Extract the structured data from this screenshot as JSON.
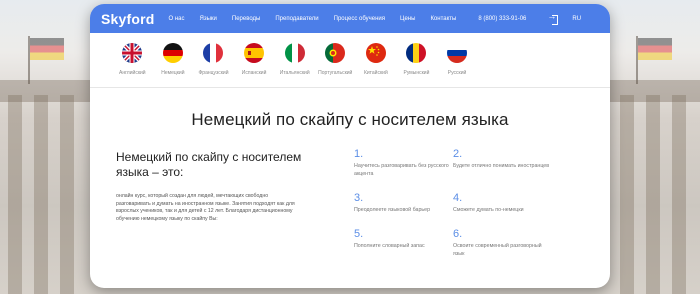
{
  "header": {
    "logo": "Skyford",
    "nav": [
      "О нас",
      "Языки",
      "Переводы",
      "Преподаватели",
      "Процесс обучения",
      "Цены",
      "Контакты"
    ],
    "phone": "8 (800) 333-91-06",
    "lang_code": "RU"
  },
  "languages": [
    {
      "label": "Английский",
      "flag": "uk"
    },
    {
      "label": "Немецкий",
      "flag": "de"
    },
    {
      "label": "Французский",
      "flag": "fr"
    },
    {
      "label": "Испанский",
      "flag": "es"
    },
    {
      "label": "Итальянский",
      "flag": "it"
    },
    {
      "label": "Португальский",
      "flag": "pt"
    },
    {
      "label": "Китайский",
      "flag": "cn"
    },
    {
      "label": "Румынский",
      "flag": "ro"
    },
    {
      "label": "Русский",
      "flag": "ru"
    }
  ],
  "main": {
    "title": "Немецкий по скайпу с носителем языка",
    "subtitle": "Немецкий по скайпу с носителем языка – это:",
    "description": "онлайн курс, который создан для людей, мечтающих свободно разговаривать и думать на иностранном языке. Занятия подходят как для взрослых учеников, так и для детей с 12 лет. Благодаря дистанционному обучению немецкому языку по скайпу Вы:"
  },
  "features": [
    {
      "num": "1.",
      "text": "Научитесь разговаривать без русского акцента"
    },
    {
      "num": "2.",
      "text": "Будете отлично понимать иностранцев"
    },
    {
      "num": "3.",
      "text": "Преодолеете языковой барьер"
    },
    {
      "num": "4.",
      "text": "Сможете думать по-немецки"
    },
    {
      "num": "5.",
      "text": "Пополните словарный запас"
    },
    {
      "num": "6.",
      "text": "Освоите современный разговорный язык"
    }
  ],
  "colors": {
    "brand": "#4c7ee8",
    "accent": "#5b8ee6"
  }
}
